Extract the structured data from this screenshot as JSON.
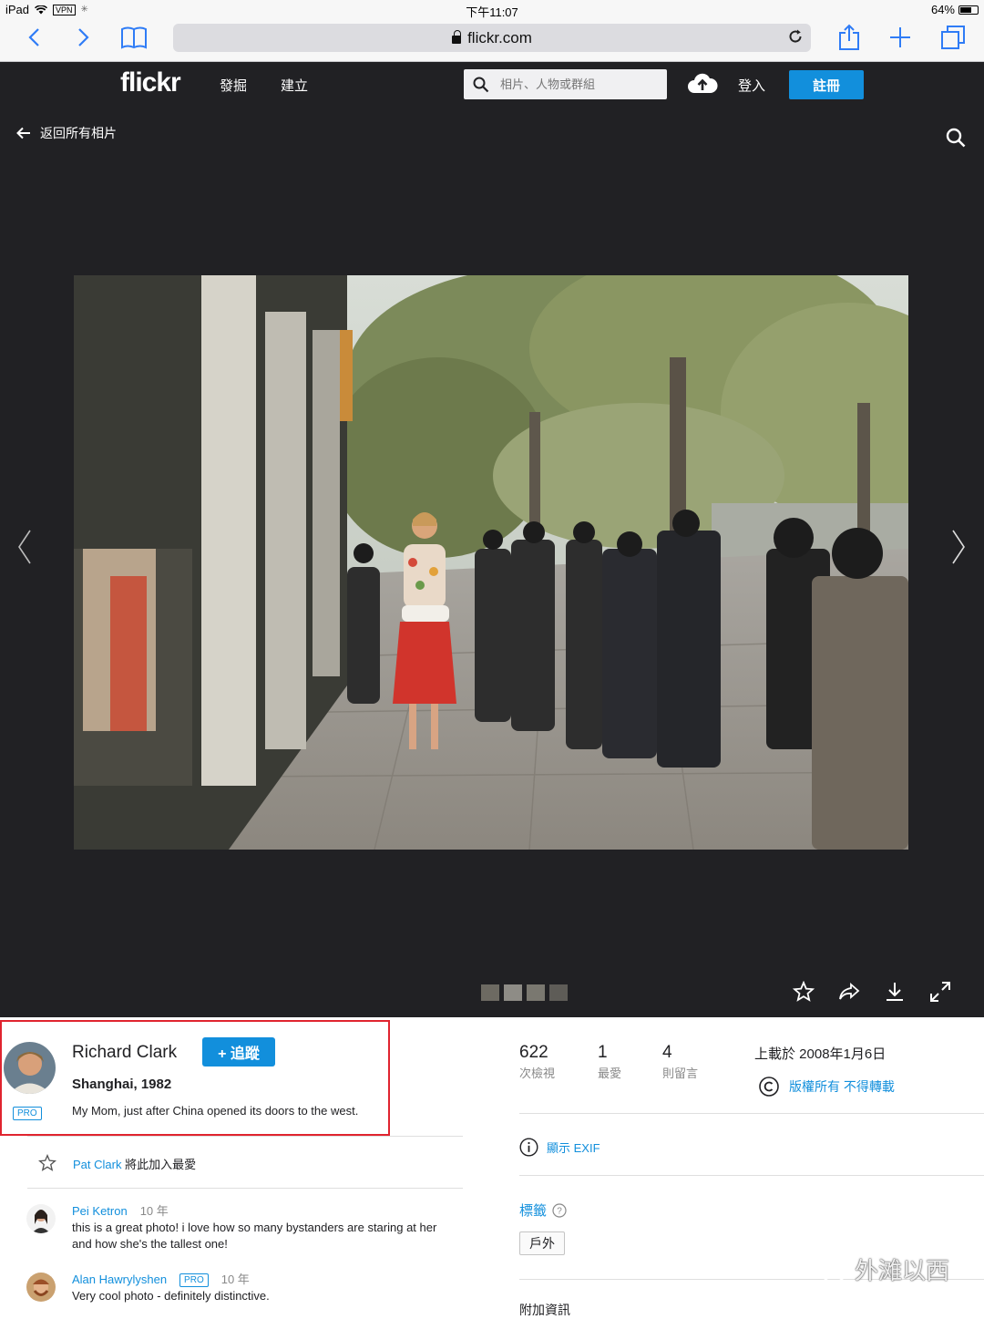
{
  "status_bar": {
    "device": "iPad",
    "vpn": "VPN",
    "time": "下午11:07",
    "battery": "64%",
    "battery_level": 0.64
  },
  "browser": {
    "url": "flickr.com"
  },
  "flickr_header": {
    "logo": "flickr",
    "nav": [
      "發掘",
      "建立"
    ],
    "search_placeholder": "相片、人物或群組",
    "login": "登入",
    "signup": "註冊"
  },
  "viewer": {
    "back_label": "返回所有相片"
  },
  "owner": {
    "name": "Richard Clark",
    "pro": "PRO",
    "follow_label": "+ 追蹤",
    "photo_title": "Shanghai, 1982",
    "photo_description": "My Mom, just after China opened its doors to the west."
  },
  "favorite_activity": {
    "user": "Pat Clark",
    "text": "將此加入最愛"
  },
  "comments": [
    {
      "user": "Pei Ketron",
      "pro": "",
      "age": "10 年",
      "text": "this is a great photo! i love how so many bystanders are staring at her and how she's the tallest one!"
    },
    {
      "user": "Alan Hawrylyshen",
      "pro": "PRO",
      "age": "10 年",
      "text": "Very cool photo - definitely distinctive."
    }
  ],
  "stats": [
    {
      "value": "622",
      "label": "次檢視"
    },
    {
      "value": "1",
      "label": "最愛"
    },
    {
      "value": "4",
      "label": "則留言"
    }
  ],
  "upload_date": "上載於 2008年1月6日",
  "license": "版權所有 不得轉載",
  "exif_label": "顯示 EXIF",
  "tags": {
    "title": "標籤",
    "items": [
      "戶外"
    ]
  },
  "more_info": "附加資訊",
  "watermark": "外滩以西",
  "colors": {
    "accent": "#128fdc",
    "dark_bg": "#212124",
    "highlight_box": "#e0242f"
  }
}
